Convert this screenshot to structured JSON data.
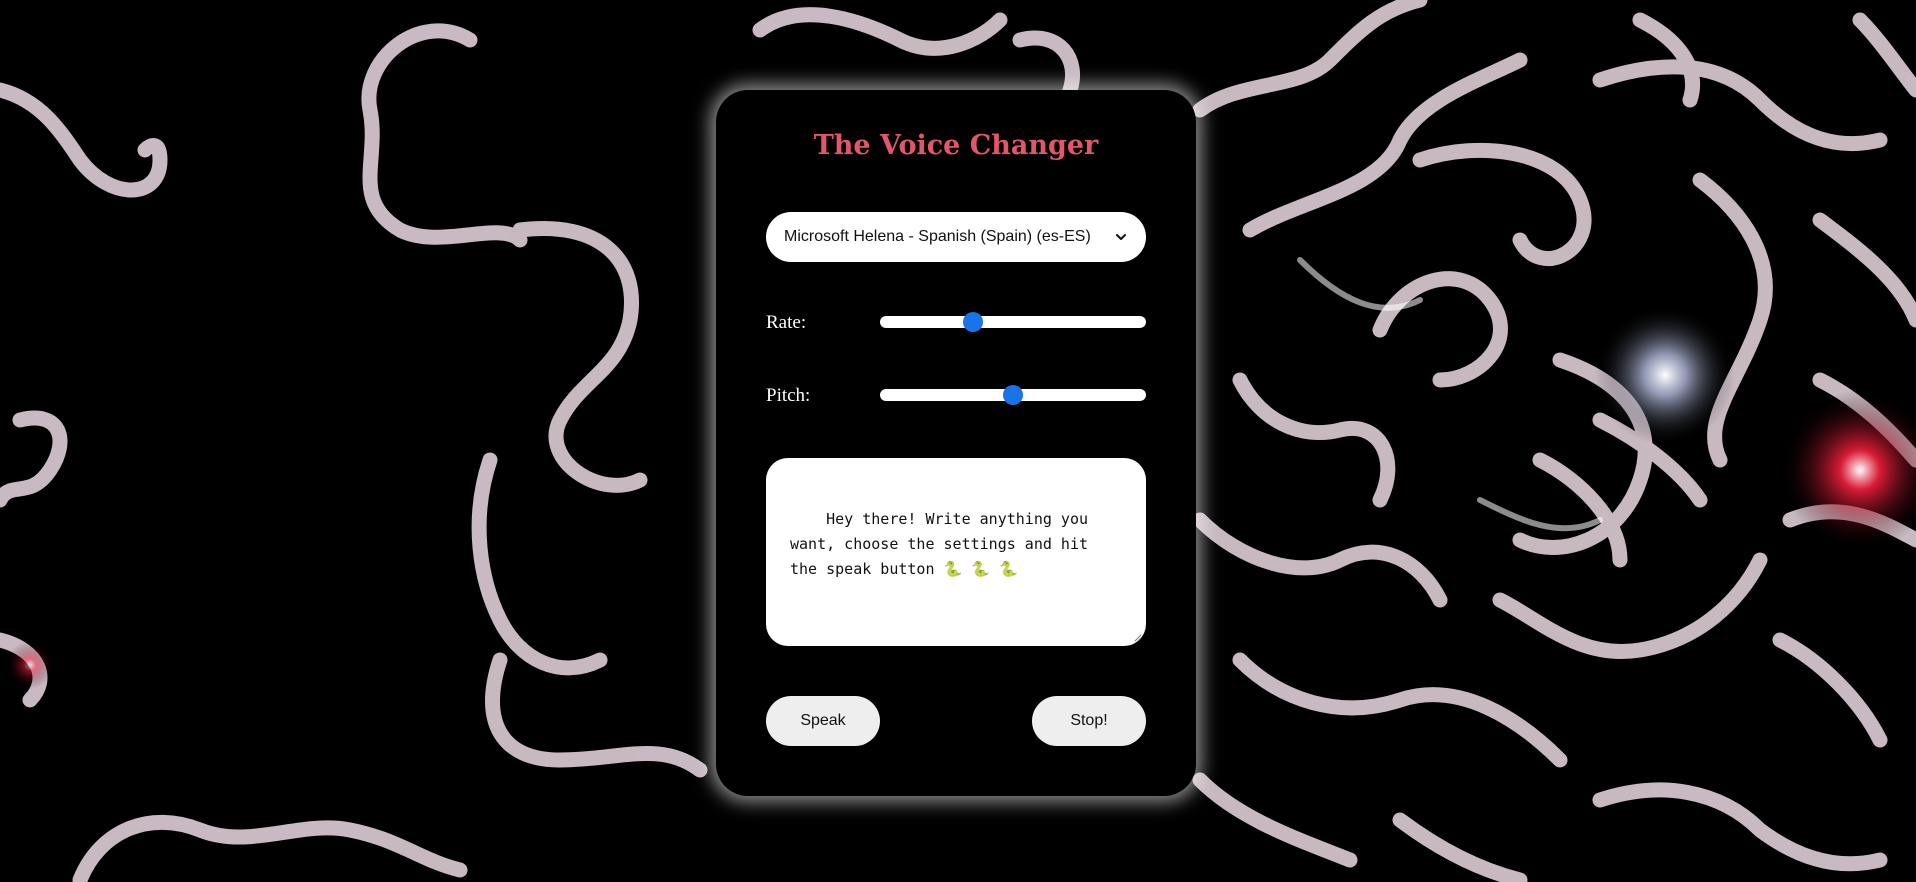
{
  "app": {
    "title": "The Voice Changer"
  },
  "voice": {
    "selected": "Microsoft Helena - Spanish (Spain) (es-ES)"
  },
  "rate": {
    "label": "Rate:",
    "level": 0.35
  },
  "pitch": {
    "label": "Pitch:",
    "level": 0.5
  },
  "text": {
    "value": "Hey there! Write anything you want, choose the settings and hit the speak button 🐍 🐍 🐍"
  },
  "buttons": {
    "speak": "Speak",
    "stop": "Stop!"
  },
  "colors": {
    "title": "#e2566a",
    "slider_thumb": "#1a73e8",
    "background": "#000000"
  }
}
